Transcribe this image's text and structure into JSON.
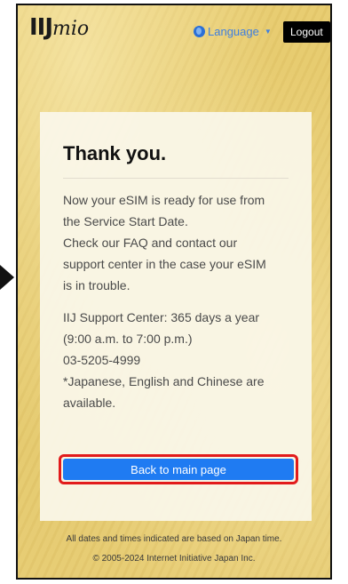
{
  "header": {
    "logo_bold": "IIJ",
    "logo_script": "mio",
    "language_label": "Language",
    "logout_label": "Logout"
  },
  "card": {
    "title": "Thank you.",
    "paragraph1": [
      "Now your eSIM is ready for use from",
      "the Service Start Date.",
      "Check our FAQ and contact our",
      "support center in the case your eSIM",
      "is in trouble."
    ],
    "paragraph2": [
      "IIJ Support Center: 365 days a year",
      "(9:00 a.m. to 7:00 p.m.)",
      "03-5205-4999",
      "*Japanese, English and Chinese are",
      "available."
    ],
    "button_label": "Back to main page"
  },
  "footer": {
    "line1": "All dates and times indicated are based on Japan time.",
    "line2": "© 2005-2024 Internet Initiative Japan Inc."
  },
  "colors": {
    "accent": "#1f7bf2",
    "highlight": "#e21b1b",
    "background": "#e6cb70"
  }
}
